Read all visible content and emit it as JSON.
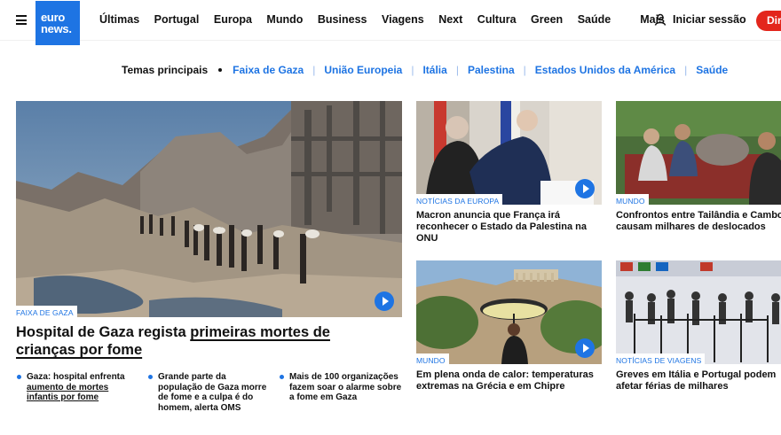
{
  "header": {
    "logo_line1": "euro",
    "logo_line2": "news.",
    "nav": [
      "Últimas",
      "Portugal",
      "Europa",
      "Mundo",
      "Business",
      "Viagens",
      "Next",
      "Cultura",
      "Green",
      "Saúde",
      "Mais"
    ],
    "login": "Iniciar sessão",
    "live": "Dire"
  },
  "topics": {
    "label": "Temas principais",
    "items": [
      "Faixa de Gaza",
      "União Europeia",
      "Itália",
      "Palestina",
      "Estados Unidos da América",
      "Saúde"
    ]
  },
  "main_story": {
    "tag": "FAIXA DE GAZA",
    "title_part1": "Hospital de Gaza regista ",
    "title_part2": "primeiras mortes de crianças por fome",
    "related": [
      {
        "prefix": "Gaza: hospital enfrenta ",
        "link": "aumento de mortes infantis por fome"
      },
      {
        "prefix": "Grande parte da população de Gaza morre de fome e a culpa é do homem, alerta OMS",
        "link": ""
      },
      {
        "prefix": "Mais de 100 organizações fazem soar o alarme sobre a fome em Gaza",
        "link": ""
      }
    ]
  },
  "cards": [
    {
      "tag": "NOTÍCIAS DA EUROPA",
      "title": "Macron anuncia que França irá reconhecer o Estado da Palestina na ONU",
      "video": true
    },
    {
      "tag": "MUNDO",
      "title": "Confrontos entre Tailândia e Camboja causam milhares de deslocados",
      "video": true
    },
    {
      "tag": "MUNDO",
      "title": "Em plena onda de calor: temperaturas extremas na Grécia e em Chipre",
      "video": true
    },
    {
      "tag": "NOTÍCIAS DE VIAGENS",
      "title": "Greves em Itália e Portugal podem afetar férias de milhares",
      "video": false
    }
  ]
}
